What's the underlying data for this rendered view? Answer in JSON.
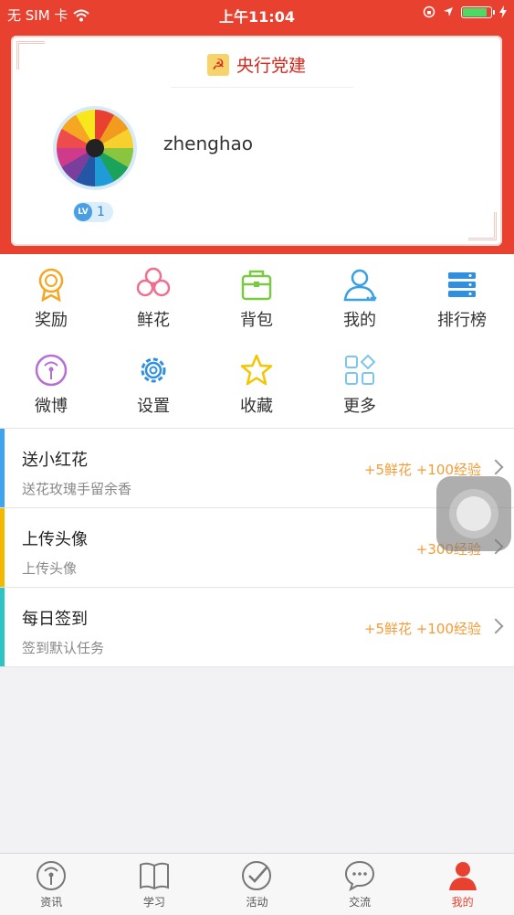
{
  "status_bar": {
    "carrier": "无 SIM 卡",
    "time": "上午11:04"
  },
  "brand": {
    "title": "央行党建",
    "logo_icon": "party-emblem-icon"
  },
  "profile": {
    "username": "zhenghao",
    "level_badge": "LV",
    "level": "1"
  },
  "grid": [
    {
      "label": "奖励",
      "icon": "award-icon",
      "color": "#f5a623"
    },
    {
      "label": "鲜花",
      "icon": "flower-icon",
      "color": "#f06f8f"
    },
    {
      "label": "背包",
      "icon": "backpack-icon",
      "color": "#7ac943"
    },
    {
      "label": "我的",
      "icon": "user-icon",
      "color": "#3aa0e4"
    },
    {
      "label": "排行榜",
      "icon": "ranking-icon",
      "color": "#2f8fe0"
    },
    {
      "label": "微博",
      "icon": "weibo-icon",
      "color": "#b56fd6"
    },
    {
      "label": "设置",
      "icon": "settings-gear-icon",
      "color": "#2f8fe0"
    },
    {
      "label": "收藏",
      "icon": "star-icon",
      "color": "#f5c500"
    },
    {
      "label": "更多",
      "icon": "more-grid-icon",
      "color": "#7cc5ec"
    }
  ],
  "tasks": [
    {
      "title": "送小红花",
      "subtitle": "送花玫瑰手留余香",
      "reward": "+5鲜花 +100经验",
      "accent": "#3fa4f0"
    },
    {
      "title": "上传头像",
      "subtitle": "上传头像",
      "reward": "+300经验",
      "accent": "#f5b800"
    },
    {
      "title": "每日签到",
      "subtitle": "签到默认任务",
      "reward": "+5鲜花 +100经验",
      "accent": "#2ec4c4"
    }
  ],
  "tabs": [
    {
      "label": "资讯",
      "icon": "news-antenna-icon",
      "active": false
    },
    {
      "label": "学习",
      "icon": "book-icon",
      "active": false
    },
    {
      "label": "活动",
      "icon": "check-circle-icon",
      "active": false
    },
    {
      "label": "交流",
      "icon": "chat-bubble-icon",
      "active": false
    },
    {
      "label": "我的",
      "icon": "profile-icon",
      "active": true
    }
  ]
}
